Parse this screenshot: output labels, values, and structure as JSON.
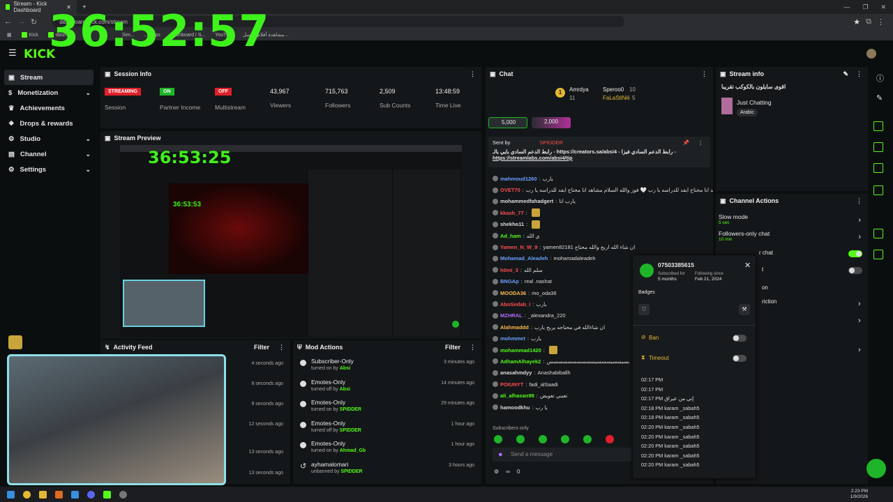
{
  "browser": {
    "tab_title": "Stream - Kick Dashboard",
    "address": "dashboard.kick.com/stream",
    "bookmarks": [
      "Kick",
      "dash...",
      "Sim...",
      "...dfaps",
      "Dashboard / S...",
      "YouTu...",
      "مشاهدة أفلام ومسل..."
    ]
  },
  "overlay_timer": "36:52:57",
  "logo": "KICK",
  "sidebar": {
    "items": [
      {
        "label": "Stream"
      },
      {
        "label": "Monetization"
      },
      {
        "label": "Achievements"
      },
      {
        "label": "Drops & rewards"
      },
      {
        "label": "Studio"
      },
      {
        "label": "Channel"
      },
      {
        "label": "Settings"
      }
    ]
  },
  "session": {
    "title": "Session Info",
    "stats": [
      {
        "badge": "STREAMING",
        "label": "Session",
        "color": "#e0202a"
      },
      {
        "badge": "ON",
        "label": "Partner Income",
        "color": "#1fb52a"
      },
      {
        "badge": "OFF",
        "label": "Multistream",
        "color": "#e0202a"
      },
      {
        "value": "43,967",
        "label": "Viewers"
      },
      {
        "value": "715,763",
        "label": "Followers"
      },
      {
        "value": "2,509",
        "label": "Sub Counts"
      },
      {
        "value": "13:48:59",
        "label": "Time Live"
      }
    ]
  },
  "preview": {
    "title": "Stream Preview",
    "inner_timer": "36:53:25",
    "nested_timer": "36:53:53"
  },
  "activity": {
    "title": "Activity Feed",
    "filter": "Filter",
    "times": [
      "4 seconds ago",
      "8 seconds ago",
      "9 seconds ago",
      "12 seconds ago",
      "13 seconds ago",
      "13 seconds ago"
    ]
  },
  "mod_actions": {
    "title": "Mod Actions",
    "filter": "Filter",
    "items": [
      {
        "title": "Subscriber-Only",
        "sub": "turned on by",
        "user": "Absi",
        "time": "3 minutes ago"
      },
      {
        "title": "Emotes-Only",
        "sub": "turned off by",
        "user": "Absi",
        "time": "14 minutes ago"
      },
      {
        "title": "Emotes-Only",
        "sub": "turned on by",
        "user": "SPIDDER",
        "time": "29 minutes ago"
      },
      {
        "title": "Emotes-Only",
        "sub": "turned off by",
        "user": "SPIDDER",
        "time": "1 hour ago"
      },
      {
        "title": "Emotes-Only",
        "sub": "turned on by",
        "user": "Ahmad_Gb",
        "time": "1 hour ago"
      },
      {
        "title": "ayhamalomari",
        "sub": "unbanned by",
        "user": "SPIDDER",
        "time": "3 hours ago"
      }
    ]
  },
  "chat": {
    "title": "Chat",
    "top_users": [
      {
        "name": "Amrdya",
        "count": "11"
      },
      {
        "name": "Speroo0",
        "count": "10"
      },
      {
        "name": "FaLaStiNiii",
        "count": "5"
      }
    ],
    "gift_a": "5,000",
    "gift_b": "2,000",
    "pinned_sent_by": "Sent by",
    "pinned_sender": "SPIDDER",
    "pinned_text": "رابط الدعم السادي بايي بالـ - https://creators.sa/absi4 - رابط الدعم السادي فيزا -",
    "pinned_link": "https://streamlabs.com/absi4/tip",
    "messages": [
      {
        "user": "mahmoud1260",
        "color": "#6aa0ff",
        "text": "يارب"
      },
      {
        "user": "OVET70",
        "color": "#ff4d4d",
        "text": "والله السلام مشاهد انا محتاج ايفد للدراسه يا رب 🤍 فوز والله السلام مشاهد انا محتاج ايفد للدراسه يا رب"
      },
      {
        "user": "mohammedfahadgert",
        "color": "#dddddd",
        "text": "يارب انا"
      },
      {
        "user": "kkash_77",
        "color": "#ff4d4d",
        "text": ""
      },
      {
        "user": "shekho11",
        "color": "#dddddd",
        "text": ""
      },
      {
        "user": "Ad_ham",
        "color": "#53fc18",
        "text": "ي الله"
      },
      {
        "user": "Yamen_N_W_9",
        "color": "#ff4d4d",
        "text": "yamen82181 ان شاء الله اربح والله محتاج"
      },
      {
        "user": "Mohamad_Aleadeh",
        "color": "#6aa0ff",
        "text": "mohamadaleadeh"
      },
      {
        "user": "h0mi_3",
        "color": "#ff4d4d",
        "text": "سلم الله"
      },
      {
        "user": "BNGAp",
        "color": "#6aa0ff",
        "text": "real .nashat"
      },
      {
        "user": "MOODA36",
        "color": "#ffb84d",
        "text": "mo_oda36"
      },
      {
        "user": "AboSedab_i",
        "color": "#ff4d4d",
        "text": "يارب"
      },
      {
        "user": "MZHRAL",
        "color": "#b06cff",
        "text": "_alexandra_220"
      },
      {
        "user": "Alahmaddd",
        "color": "#ffb84d",
        "text": "ان شاءالله في محتاجه يربح يارب"
      },
      {
        "user": "mohmmet",
        "color": "#6aa0ff",
        "text": "يارب"
      },
      {
        "user": "mohammad1420",
        "color": "#53fc18",
        "text": ""
      },
      {
        "user": "AdhamAlhayek2",
        "color": "#53fc18",
        "text": "بسيسسيسسسيسسسسسسسسسس"
      },
      {
        "user": "anasahmdyy",
        "color": "#dddddd",
        "text": "Anashabiballh"
      },
      {
        "user": "POIUNYT",
        "color": "#ff4d4d",
        "text": "fadi_alSaadi"
      },
      {
        "user": "ali_alhasan98",
        "color": "#53fc18",
        "text": "تعبني تعويض"
      },
      {
        "user": "hamoodkhu",
        "color": "#dddddd",
        "text": "يا رب"
      }
    ],
    "subscribers_only": "Subscribers only",
    "input_placeholder": "Send a message",
    "footer_count": "0"
  },
  "user_card": {
    "username": "07503385615",
    "subscribed_label": "Subscribed for",
    "subscribed_value": "5 months",
    "following_label": "Following since",
    "following_value": "Feb 21, 2024",
    "badges_label": "Badges",
    "ban_label": "Ban",
    "timeout_label": "Timeout",
    "log": [
      "02:17 PM",
      "02:17 PM",
      "02:17 PM إني من عيراق",
      "02:18 PM karam _sabah5",
      "02:18 PM karam _sabah5",
      "02:20 PM karam _sabah5",
      "02:20 PM karam _sabah5",
      "02:20 PM karam _sabah5",
      "02:20 PM karam _sabah5",
      "02:20 PM karam _sabah5"
    ]
  },
  "stream_info": {
    "title": "Stream info",
    "stream_title": "اقوى سايلون بالكوكب تقريبا",
    "category": "Just Chatting",
    "language": "Arabic"
  },
  "channel_actions": {
    "title": "Channel Actions",
    "items": [
      {
        "label": "Slow mode",
        "sub": "5 sec"
      },
      {
        "label": "Followers-only chat",
        "sub": "10 min"
      },
      {
        "label": "r chat",
        "sub": ""
      },
      {
        "label": "t",
        "sub": ""
      },
      {
        "label": "on",
        "sub": ""
      },
      {
        "label": "riction",
        "sub": ""
      }
    ]
  },
  "taskbar": {
    "time": "2:23 PM",
    "date": "1/9/2026"
  }
}
